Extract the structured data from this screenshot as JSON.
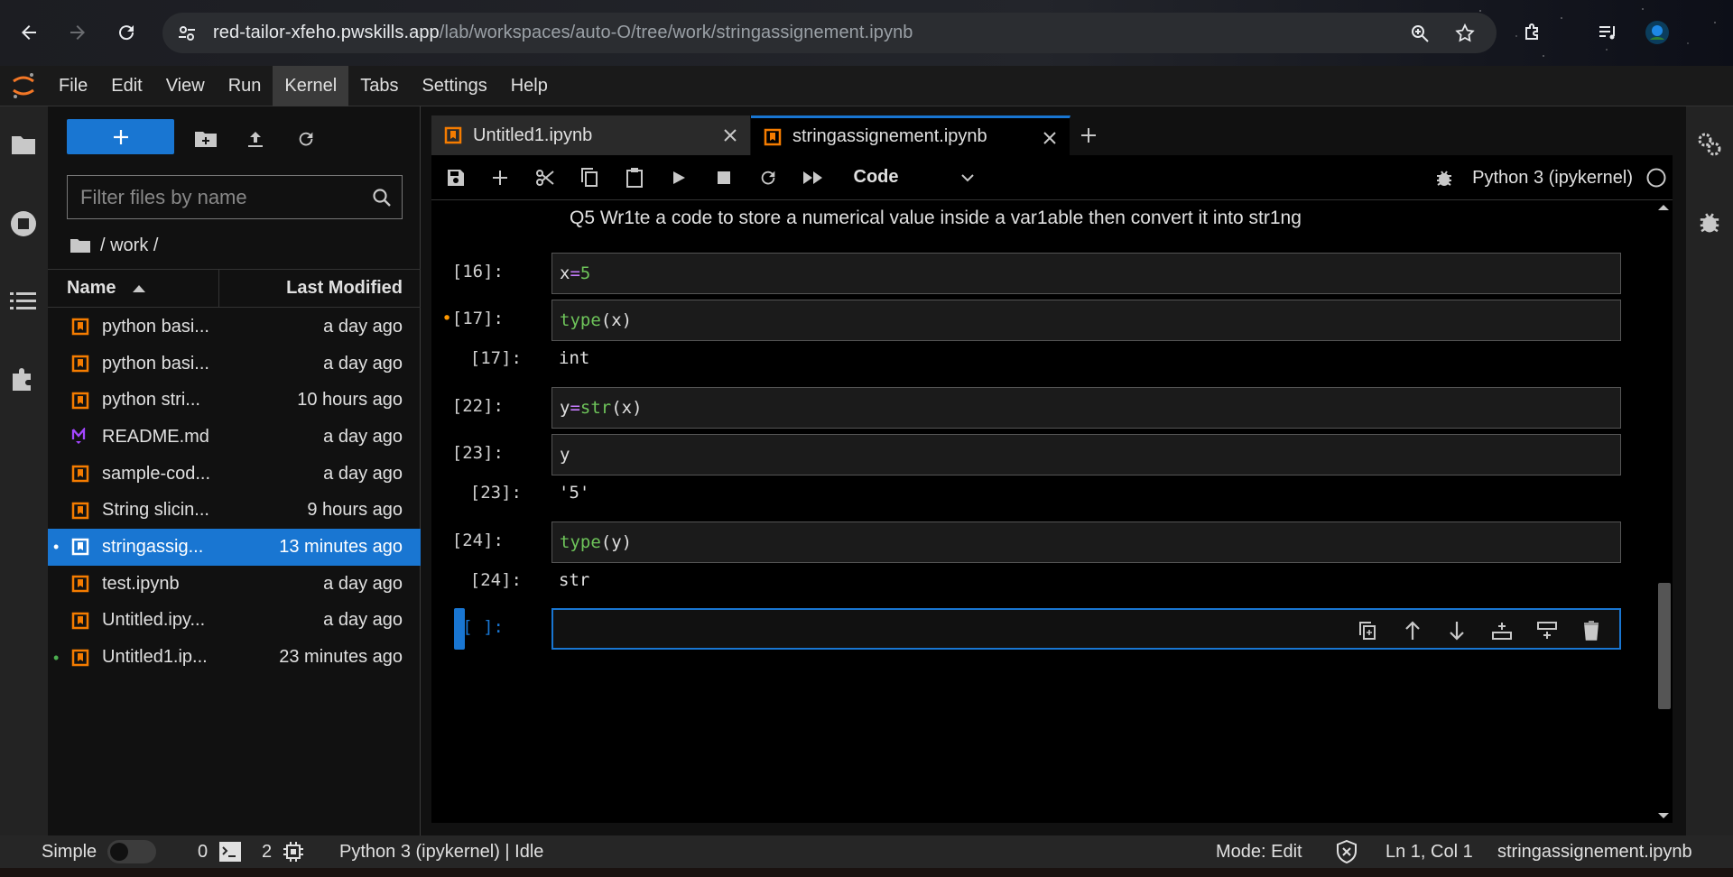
{
  "browser": {
    "url_host": "red-tailor-xfeho.pwskills.app",
    "url_path": "/lab/workspaces/auto-O/tree/work/stringassignement.ipynb"
  },
  "menu": [
    "File",
    "Edit",
    "View",
    "Run",
    "Kernel",
    "Tabs",
    "Settings",
    "Help"
  ],
  "filebrowser": {
    "filter_placeholder": "Filter files by name",
    "breadcrumb": "/ work /",
    "col_name": "Name",
    "col_modified": "Last Modified",
    "files": [
      {
        "name": "python basi...",
        "modified": "a day ago",
        "icon": "notebook-icon",
        "dot": ""
      },
      {
        "name": "python basi...",
        "modified": "a day ago",
        "icon": "notebook-icon",
        "dot": ""
      },
      {
        "name": "python stri...",
        "modified": "10 hours ago",
        "icon": "notebook-icon",
        "dot": ""
      },
      {
        "name": "README.md",
        "modified": "a day ago",
        "icon": "markdown-icon",
        "dot": ""
      },
      {
        "name": "sample-cod...",
        "modified": "a day ago",
        "icon": "notebook-icon",
        "dot": ""
      },
      {
        "name": "String slicin...",
        "modified": "9 hours ago",
        "icon": "notebook-icon",
        "dot": ""
      },
      {
        "name": "stringassig...",
        "modified": "13 minutes ago",
        "icon": "notebook-icon",
        "dot": "•"
      },
      {
        "name": "test.ipynb",
        "modified": "a day ago",
        "icon": "notebook-icon",
        "dot": ""
      },
      {
        "name": "Untitled.ipy...",
        "modified": "a day ago",
        "icon": "notebook-icon",
        "dot": ""
      },
      {
        "name": "Untitled1.ip...",
        "modified": "23 minutes ago",
        "icon": "notebook-icon",
        "dot": "•"
      }
    ]
  },
  "tabs": [
    {
      "label": "Untitled1.ipynb"
    },
    {
      "label": "stringassignement.ipynb"
    }
  ],
  "toolbar": {
    "cell_type": "Code",
    "kernel_name": "Python 3 (ipykernel)"
  },
  "notebook": {
    "markdown": "Q5 Wr1te a code to store a numerical value inside a var1able then convert it into str1ng",
    "cells": [
      {
        "prompt": "[16]:",
        "modified": ""
      },
      {
        "prompt": "[17]:",
        "modified": "•",
        "output_prompt": "[17]:",
        "output": "int"
      },
      {
        "prompt": "[22]:",
        "modified": ""
      },
      {
        "prompt": "[23]:",
        "modified": "",
        "output_prompt": "[23]:",
        "output": "'5'"
      },
      {
        "prompt": "[24]:",
        "modified": "",
        "output_prompt": "[24]:",
        "output": "str"
      },
      {
        "prompt": "[ ]:",
        "modified": ""
      }
    ]
  },
  "statusbar": {
    "simple_label": "Simple",
    "terminals": "0",
    "kernels": "2",
    "kernel_status": "Python 3 (ipykernel) | Idle",
    "mode": "Mode: Edit",
    "cursor": "Ln 1, Col 1",
    "filename": "stringassignement.ipynb"
  },
  "colors": {
    "accent": "#1976d2",
    "notebook_icon": "#f57c00",
    "markdown_icon": "#a346ff",
    "code_keyword": "#6ec45a",
    "code_operator": "#c77dff"
  }
}
